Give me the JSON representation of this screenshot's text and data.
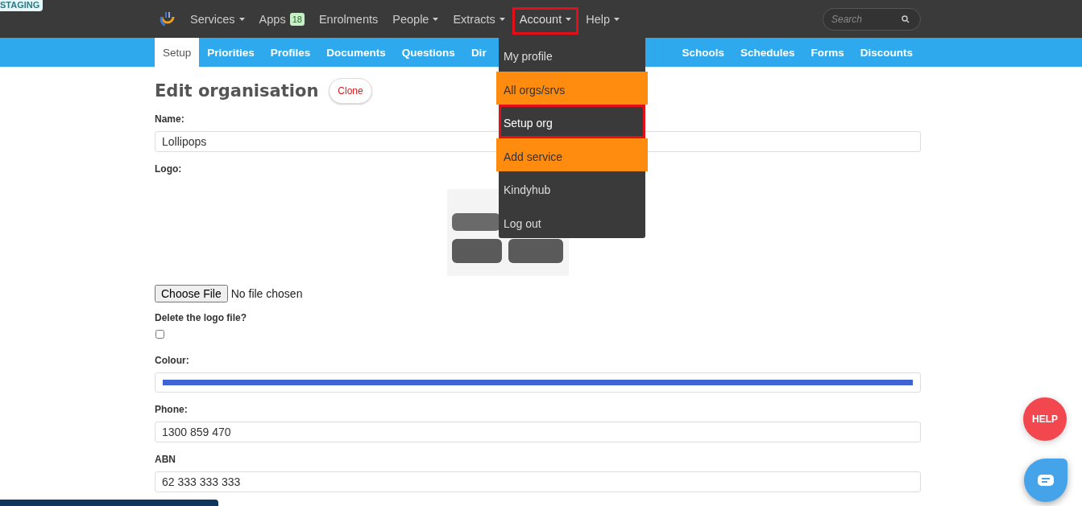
{
  "env_badge": "STAGING",
  "nav": {
    "items": [
      {
        "label": "Services",
        "caret": true,
        "outlined": false
      },
      {
        "label": "Apps",
        "caret": false,
        "count": "18",
        "outlined": false
      },
      {
        "label": "Enrolments",
        "caret": false,
        "outlined": false
      },
      {
        "label": "People",
        "caret": true,
        "outlined": false
      },
      {
        "label": "Extracts",
        "caret": true,
        "outlined": false
      },
      {
        "label": "Account",
        "caret": true,
        "outlined": true
      },
      {
        "label": "Help",
        "caret": true,
        "outlined": false
      }
    ],
    "search": {
      "placeholder": "Search"
    }
  },
  "subnav": {
    "tabs": [
      {
        "label": "Setup",
        "selected": true
      },
      {
        "label": "Priorities",
        "selected": false
      },
      {
        "label": "Profiles",
        "selected": false
      },
      {
        "label": "Documents",
        "selected": false
      },
      {
        "label": "Questions",
        "selected": false
      },
      {
        "label": "Dir",
        "selected": false
      }
    ],
    "tabs_after_menu": [
      {
        "label": "Schools",
        "selected": false
      },
      {
        "label": "Schedules",
        "selected": false
      },
      {
        "label": "Forms",
        "selected": false
      },
      {
        "label": "Discounts",
        "selected": false
      }
    ]
  },
  "account_menu": [
    {
      "label": "My profile",
      "highlighted": false,
      "outlined": false
    },
    {
      "label": "All orgs/srvs",
      "highlighted": true,
      "outlined": false
    },
    {
      "label": "Setup org",
      "highlighted": false,
      "outlined": true
    },
    {
      "label": "Add service",
      "highlighted": true,
      "outlined": false
    },
    {
      "label": "Kindyhub",
      "highlighted": false,
      "outlined": false
    },
    {
      "label": "Log out",
      "highlighted": false,
      "outlined": false
    }
  ],
  "page": {
    "title": "Edit organisation",
    "clone_button": "Clone"
  },
  "form": {
    "name": {
      "label": "Name:",
      "value": "Lollipops"
    },
    "logo": {
      "label": "Logo:",
      "kind": "picture"
    },
    "file": {
      "button": "Choose File",
      "status": "No file chosen"
    },
    "delete_logo": {
      "label": "Delete the logo file?",
      "checked": false
    },
    "colour": {
      "label": "Colour:",
      "color": "#3f63d3"
    },
    "phone": {
      "label": "Phone:",
      "value": "1300 859 470"
    },
    "abn": {
      "label": "ABN",
      "value": "62 333 333 333"
    }
  },
  "help_button": "HELP"
}
